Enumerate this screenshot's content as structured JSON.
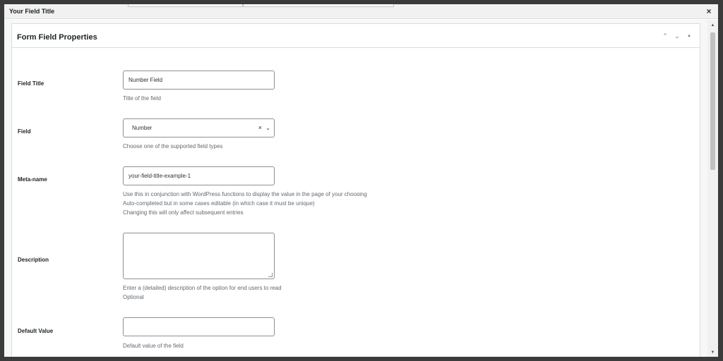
{
  "modal": {
    "title": "Your Field Title",
    "close_glyph": "×"
  },
  "postbox": {
    "title": "Form Field Properties",
    "move_up_glyph": "⌃",
    "move_down_glyph": "⌄",
    "toggle_glyph": "▲"
  },
  "fields": {
    "field_title": {
      "label": "Field Title",
      "value": "Number Field",
      "help": "Title of the field"
    },
    "field": {
      "label": "Field",
      "selected": "Number",
      "clear_glyph": "×",
      "arrow_glyph": "⌄",
      "help": "Choose one of the supported field types"
    },
    "meta_name": {
      "label": "Meta-name",
      "value": "your-field-title-example-1",
      "help_lines": [
        "Use this in conjunction with WordPress functions to display the value in the page of your choosing",
        "Auto-completed but in some cases editable (in which case it must be unique)",
        "Changing this will only affect subsequent entries"
      ]
    },
    "description": {
      "label": "Description",
      "value": "",
      "help_lines": [
        "Enter a (detailed) description of the option for end users to read",
        "Optional"
      ]
    },
    "default_value": {
      "label": "Default Value",
      "value": "",
      "help": "Default value of the field"
    }
  },
  "scrollbar": {
    "up_glyph": "▲",
    "down_glyph": "▼"
  },
  "icons": [
    "close-icon",
    "chevron-up-icon",
    "chevron-down-icon",
    "triangle-up-icon",
    "chevron-down-icon"
  ]
}
